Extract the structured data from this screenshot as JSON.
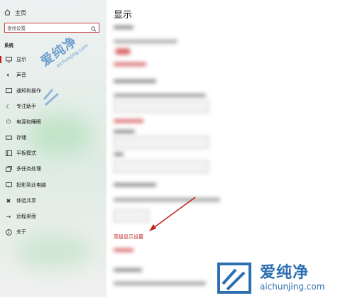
{
  "sidebar": {
    "home_label": "主页",
    "search_placeholder": "查找设置",
    "section_title": "系统",
    "items": [
      {
        "icon": "monitor-icon",
        "label": "显示",
        "active": true
      },
      {
        "icon": "speaker-icon",
        "label": "声音"
      },
      {
        "icon": "notification-icon",
        "label": "通知和操作"
      },
      {
        "icon": "moon-icon",
        "label": "专注助手"
      },
      {
        "icon": "power-icon",
        "label": "电源和睡眠"
      },
      {
        "icon": "storage-icon",
        "label": "存储"
      },
      {
        "icon": "tablet-icon",
        "label": "平板模式"
      },
      {
        "icon": "multitask-icon",
        "label": "多任务处理"
      },
      {
        "icon": "project-icon",
        "label": "投影到此电脑"
      },
      {
        "icon": "share-icon",
        "label": "体验共享"
      },
      {
        "icon": "remote-icon",
        "label": "远程桌面"
      },
      {
        "icon": "info-icon",
        "label": "关于"
      }
    ]
  },
  "main": {
    "title": "显示",
    "advanced_link": "高级显示设置"
  },
  "watermark": {
    "cn": "爱纯净",
    "url": "aichunjing.com"
  },
  "colors": {
    "accent": "#c02020",
    "watermark": "#2d6fb0"
  }
}
